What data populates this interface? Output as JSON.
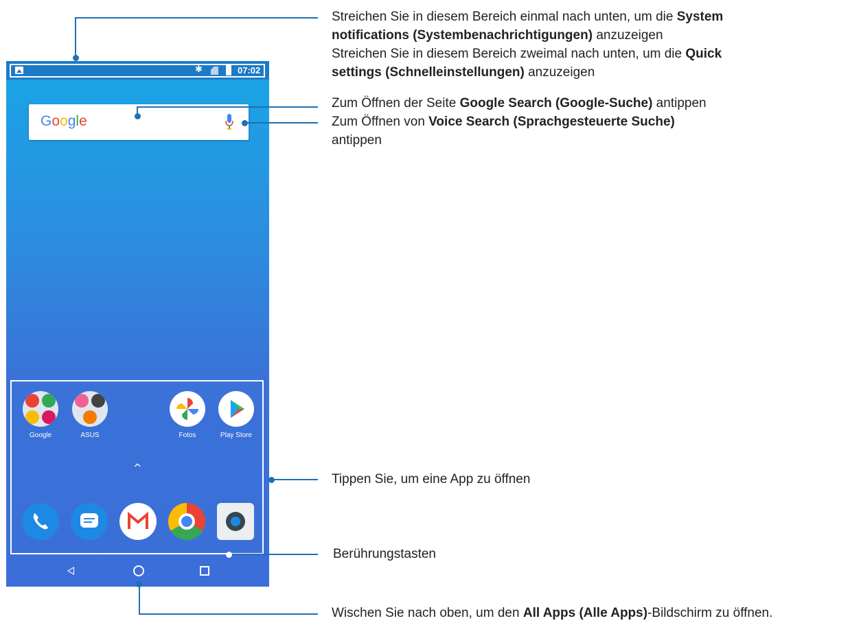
{
  "phone": {
    "status_time": "07:02",
    "search_logo": [
      "G",
      "o",
      "o",
      "g",
      "l",
      "e"
    ],
    "apps_row": [
      {
        "label": "Google",
        "icon": "google-folder-icon"
      },
      {
        "label": "ASUS",
        "icon": "asus-folder-icon"
      },
      {
        "label": "Fotos",
        "icon": "photos-pinwheel-icon"
      },
      {
        "label": "Play Store",
        "icon": "play-store-icon"
      }
    ],
    "dock": [
      "phone-icon",
      "messages-icon",
      "gmail-icon",
      "chrome-icon",
      "camera-icon"
    ],
    "caret": "^"
  },
  "callouts": {
    "c1_l1_a": "Streichen Sie in diesem Bereich einmal nach unten, um die ",
    "c1_l1_b": "System",
    "c1_l2_b": "notifications (Systembenachrichtigungen)",
    "c1_l2_c": " anzuzeigen",
    "c1_l3_a": "Streichen Sie in diesem Bereich zweimal nach unten, um die ",
    "c1_l3_b": "Quick",
    "c1_l4_b": "settings (Schnelleinstellungen)",
    "c1_l4_c": " anzuzeigen",
    "c2_a": "Zum Öffnen der Seite ",
    "c2_b": "Google Search (Google-Suche)",
    "c2_c": " antippen",
    "c3_a": "Zum Öffnen von ",
    "c3_b": "Voice Search (Sprachgesteuerte Suche)",
    "c3_l2": "antippen",
    "c4": "Tippen Sie, um eine App zu öffnen",
    "c5": "Berührungstasten",
    "c6_a": "Wischen Sie nach oben, um den ",
    "c6_b": "All Apps (Alle Apps)",
    "c6_c": "-Bildschirm zu öffnen."
  },
  "colors": {
    "callout_line": "#1f6fb5",
    "wallpaper_top": "#19a6e6",
    "wallpaper_bottom": "#3b6ed8"
  }
}
